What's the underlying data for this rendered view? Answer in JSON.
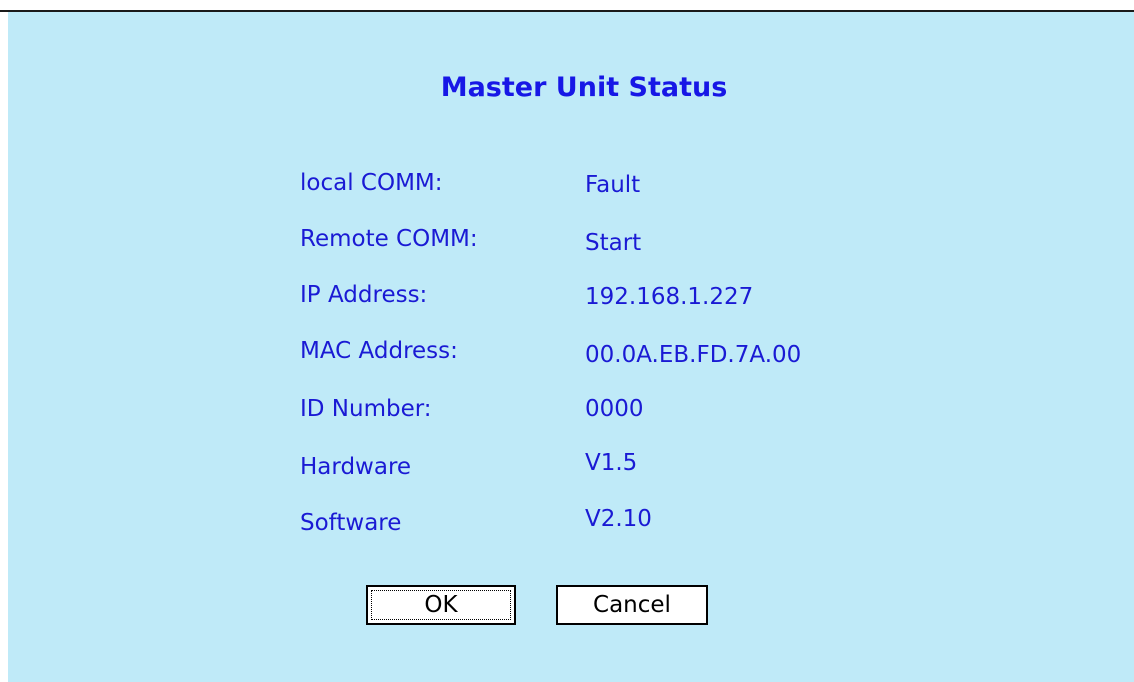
{
  "dialog": {
    "title": "Master Unit Status",
    "rows": [
      {
        "label": "local COMM:",
        "value": "Fault"
      },
      {
        "label": "Remote COMM:",
        "value": "Start"
      },
      {
        "label": "IP Address:",
        "value": "192.168.1.227"
      },
      {
        "label": "MAC Address:",
        "value": "00.0A.EB.FD.7A.00"
      },
      {
        "label": "ID Number:",
        "value": "0000"
      },
      {
        "label": "Hardware",
        "value": "V1.5"
      },
      {
        "label": "Software",
        "value": "V2.10"
      }
    ],
    "ok_label": "OK",
    "cancel_label": "Cancel"
  },
  "colors": {
    "background": "#bfeaf8",
    "text": "#1a1ad4",
    "title": "#1717e6"
  }
}
